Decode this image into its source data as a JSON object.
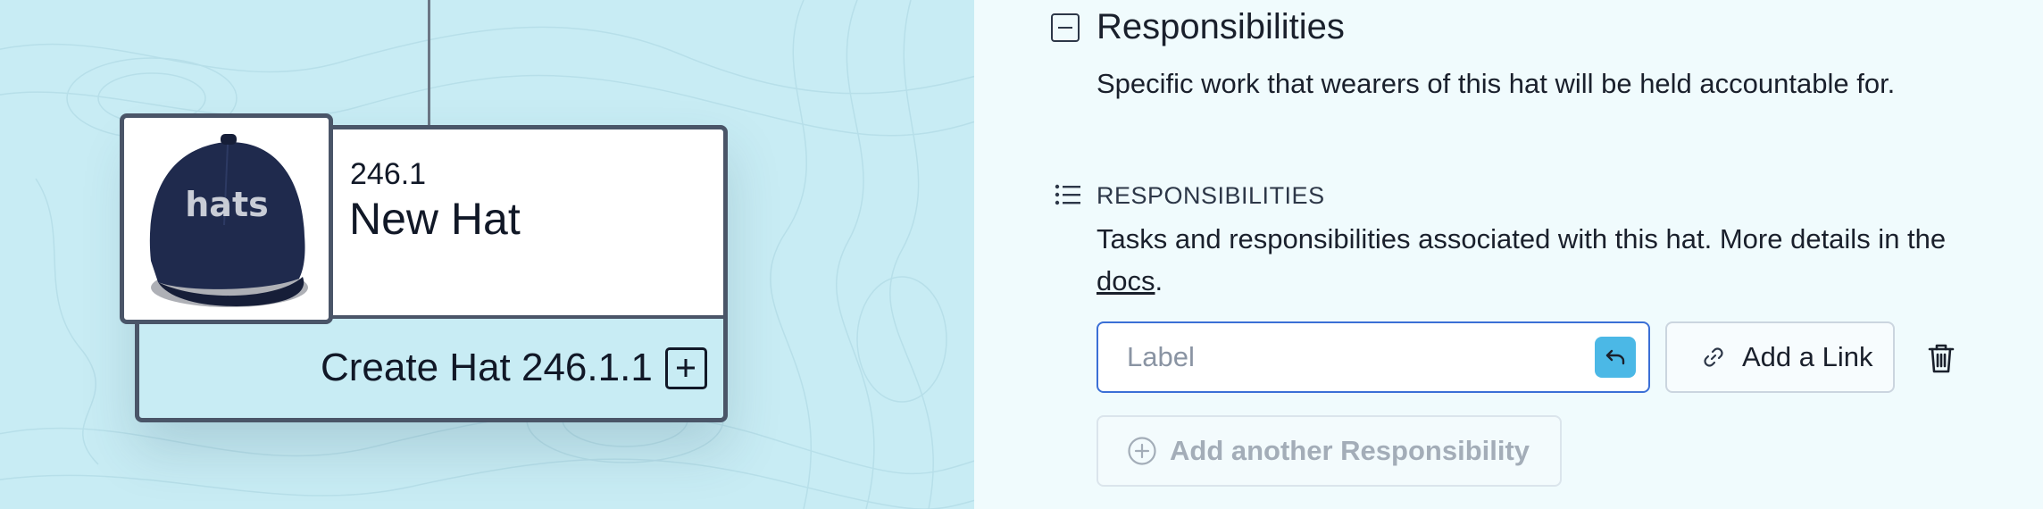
{
  "colors": {
    "canvas_bg": "#c8ecf4",
    "panel_bg": "#f0fbfd",
    "node_border": "#4a5568",
    "input_focus": "#3b6fd6",
    "undo_button": "#4bb8e6"
  },
  "hat_node": {
    "image_text": "hats",
    "id": "246.1",
    "name": "New Hat",
    "create_label": "Create Hat 246.1.1",
    "create_icon": "plus-icon"
  },
  "section": {
    "toggle_icon": "collapse-minus-icon",
    "title": "Responsibilities",
    "description": "Specific work that wearers of this hat will be held accountable for."
  },
  "field": {
    "icon": "list-icon",
    "label": "RESPONSIBILITIES",
    "help_text": "Tasks and responsibilities associated with this hat. More details in the ",
    "help_link": "docs",
    "help_suffix": "."
  },
  "responsibility_row": {
    "label_input": {
      "value": "",
      "placeholder": "Label"
    },
    "undo_icon": "undo-icon",
    "add_link_icon": "link-icon",
    "add_link_label": "Add a Link",
    "delete_icon": "trash-icon"
  },
  "add_another": {
    "icon": "plus-circle-icon",
    "label": "Add another Responsibility"
  }
}
